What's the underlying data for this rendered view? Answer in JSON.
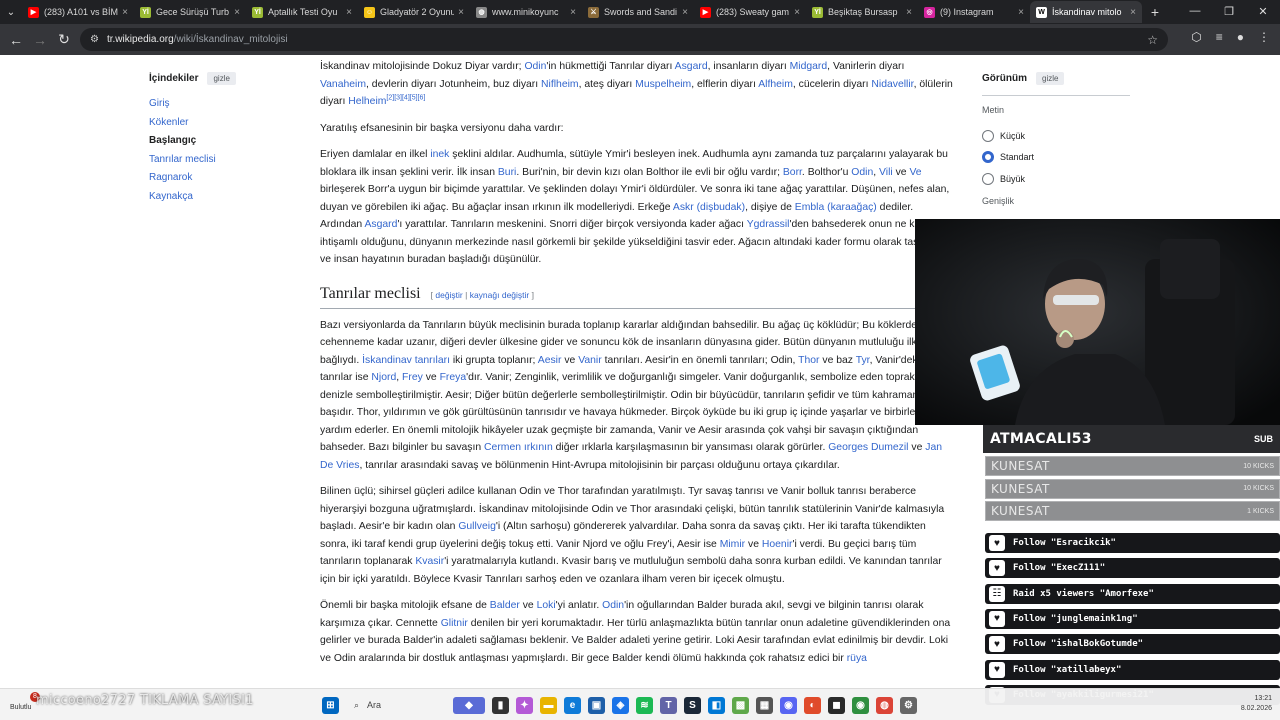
{
  "browser": {
    "tabs": [
      {
        "title": "(283) A101 vs BİM",
        "color": "#ff0000",
        "glyph": "▶"
      },
      {
        "title": "Gece Sürüşü Turb",
        "color": "#9bbb34",
        "glyph": "Yİ"
      },
      {
        "title": "Aptallık Testi Oyu",
        "color": "#9bbb34",
        "glyph": "Yİ"
      },
      {
        "title": "Gladyatör 2 Oyunu",
        "color": "#f5c518",
        "glyph": "☺"
      },
      {
        "title": "www.minikoyunc",
        "color": "#888888",
        "glyph": "◍"
      },
      {
        "title": "Swords and Sandi",
        "color": "#8b6b3a",
        "glyph": "⚔"
      },
      {
        "title": "(283) Sweaty gam",
        "color": "#ff0000",
        "glyph": "▶"
      },
      {
        "title": "Beşiktaş Bursasp",
        "color": "#9bbb34",
        "glyph": "Yİ"
      },
      {
        "title": "(9) Instagram",
        "color": "#d6249f",
        "glyph": "◎"
      },
      {
        "title": "İskandinav mitolo",
        "color": "#ffffff",
        "glyph": "W"
      }
    ],
    "url_host": "tr.wikipedia.org",
    "url_path": "/wiki/İskandinav_mitolojisi"
  },
  "toc": {
    "title": "İçindekiler",
    "hide": "gizle",
    "items": [
      "Giriş",
      "Kökenler",
      "Başlangıç",
      "Tanrılar meclisi",
      "Ragnarok",
      "Kaynakça"
    ]
  },
  "appearance": {
    "title": "Görünüm",
    "hide": "gizle",
    "text_label": "Metin",
    "options": [
      "Küçük",
      "Standart",
      "Büyük"
    ],
    "width_label": "Genişlik"
  },
  "article": {
    "p1": [
      [
        "t",
        "İskandinav mitolojisinde Dokuz Diyar vardır; "
      ],
      [
        "l",
        "Odin"
      ],
      [
        "t",
        "'in hükmettiği Tanrılar diyarı "
      ],
      [
        "l",
        "Asgard"
      ],
      [
        "t",
        ", insanların diyarı "
      ],
      [
        "l",
        "Midgard"
      ],
      [
        "t",
        ", Vanirlerin diyarı "
      ],
      [
        "l",
        "Vanaheim"
      ],
      [
        "t",
        ", devlerin diyarı Jotunheim, buz diyarı "
      ],
      [
        "l",
        "Niflheim"
      ],
      [
        "t",
        ", ateş diyarı "
      ],
      [
        "l",
        "Muspelheim"
      ],
      [
        "t",
        ", elflerin diyarı "
      ],
      [
        "l",
        "Alfheim"
      ],
      [
        "t",
        ", cücelerin diyarı "
      ],
      [
        "l",
        "Nidavellir"
      ],
      [
        "t",
        ", ölülerin diyarı "
      ],
      [
        "l",
        "Helheim"
      ],
      [
        "s",
        "[2][3][4][5][6]"
      ]
    ],
    "p2": [
      [
        "t",
        "Yaratılış efsanesinin bir başka versiyonu daha vardır:"
      ]
    ],
    "p3": [
      [
        "t",
        "Eriyen damlalar en ilkel "
      ],
      [
        "l",
        "inek"
      ],
      [
        "t",
        " şeklini aldılar. Audhumla, sütüyle Ymir'i besleyen inek. Audhumla aynı zamanda tuz parçalarını yalayarak bu bloklara ilk insan şeklini verir. İlk insan "
      ],
      [
        "l",
        "Buri"
      ],
      [
        "t",
        ". Buri'nin, bir devin kızı olan Bolthor ile evli bir oğlu vardır; "
      ],
      [
        "l",
        "Borr"
      ],
      [
        "t",
        ". Bolthor'u "
      ],
      [
        "l",
        "Odin"
      ],
      [
        "t",
        ", "
      ],
      [
        "l",
        "Vili"
      ],
      [
        "t",
        " ve "
      ],
      [
        "l",
        "Ve"
      ],
      [
        "t",
        " birleşerek Borr'a uygun bir biçimde yarattılar. Ve şeklinden dolayı Ymir'i öldürdüler. Ve sonra iki tane ağaç yarattılar. Düşünen, nefes alan, duyan ve görebilen iki ağaç. Bu ağaçlar insan ırkının ilk modelleriydi. Erkeğe "
      ],
      [
        "l",
        "Askr (dişbudak)"
      ],
      [
        "t",
        ", dişiye de "
      ],
      [
        "l",
        "Embla (karaağaç)"
      ],
      [
        "t",
        " dediler. Ardından "
      ],
      [
        "l",
        "Asgard"
      ],
      [
        "t",
        "'ı yarattılar. Tanrıların meskenini. Snorri diğer birçok versiyonda kader ağacı "
      ],
      [
        "l",
        "Ygdrassil"
      ],
      [
        "t",
        "'den bahsederek onun ne kadar ihtişamlı olduğunu, dünyanın merkezinde nasıl görkemli bir şekilde yükseldiğini tasvir eder. Ağacın altındaki kader formu olarak tasvir edilir ve insan hayatının buradan başladığı düşünülür."
      ]
    ],
    "h2_title": "Tanrılar meclisi",
    "h2_edit_open": "[ ",
    "h2_edit1": "değiştir",
    "h2_edit_sep": " | ",
    "h2_edit2": "kaynağı değiştir",
    "h2_edit_close": " ]",
    "p4": [
      [
        "t",
        "Bazı versiyonlarda da Tanrıların büyük meclisinin burada toplanıp kararlar aldığından bahsedilir. Bu ağaç üç köklüdür; Bu köklerden biri cehenneme kadar uzanır, diğeri devler ülkesine gider ve sonuncu kök de insanların dünyasına gider. Bütün dünyanın mutluluğu ilk ağaca bağlıydı. "
      ],
      [
        "l",
        "İskandinav tanrıları"
      ],
      [
        "t",
        " iki grupta toplanır; "
      ],
      [
        "l",
        "Aesir"
      ],
      [
        "t",
        " ve "
      ],
      [
        "l",
        "Vanir"
      ],
      [
        "t",
        " tanrıları. Aesir'in en önemli tanrıları; Odin, "
      ],
      [
        "l",
        "Thor"
      ],
      [
        "t",
        " ve baz "
      ],
      [
        "l",
        "Tyr"
      ],
      [
        "t",
        ", Vanir'deki önemli tanrılar ise "
      ],
      [
        "l",
        "Njord"
      ],
      [
        "t",
        ", "
      ],
      [
        "l",
        "Frey"
      ],
      [
        "t",
        " ve "
      ],
      [
        "l",
        "Freya"
      ],
      [
        "t",
        "'dır. Vanir; Zenginlik, verimlilik ve doğurganlığı simgeler. Vanir doğurganlık, sembolize eden toprak ve denizle sembolleştirilmiştir. Aesir; Diğer bütün değerlerle sembolleştirilmiştir. Odin bir büyücüdür, tanrıların şefidir ve tüm kahramanların başıdır. Thor, yıldırımın ve gök gürültüsünün tanrısıdır ve havaya hükmeder. Birçok öyküde bu iki grup iç içinde yaşarlar ve birbirlerine yardım ederler. En önemli mitolojik hikâyeler uzak geçmişte bir zamanda, Vanir ve Aesir arasında çok vahşi bir savaşın çıktığından bahseder. Bazı bilginler bu savaşın "
      ],
      [
        "l",
        "Cermen ırkının"
      ],
      [
        "t",
        " diğer ırklarla karşılaşmasının bir yansıması olarak görürler. "
      ],
      [
        "l",
        "Georges Dumezil"
      ],
      [
        "t",
        " ve "
      ],
      [
        "l",
        "Jan De Vries"
      ],
      [
        "t",
        ", tanrılar arasındaki savaş ve bölünmenin Hint-Avrupa mitolojisinin bir parçası olduğunu ortaya çıkardılar."
      ]
    ],
    "p5": [
      [
        "t",
        "Bilinen üçlü; sihirsel güçleri adilce kullanan Odin ve Thor tarafından yaratılmıştı. Tyr savaş tanrısı ve Vanir bolluk tanrısı beraberce hiyerarşiyi bozguna uğratmışlardı. İskandinav mitolojisinde Odin ve Thor arasındaki çelişki, bütün tanrılık statülerinin Vanir'de kalmasıyla başladı. Aesir'e bir kadın olan "
      ],
      [
        "l",
        "Gullveig"
      ],
      [
        "t",
        "'i (Altın sarhoşu) göndererek yalvardılar. Daha sonra da savaş çıktı. Her iki tarafta tükendikten sonra, iki taraf kendi grup üyelerini değiş tokuş etti. Vanir Njord ve oğlu Frey'i, Aesir ise "
      ],
      [
        "l",
        "Mimir"
      ],
      [
        "t",
        " ve "
      ],
      [
        "l",
        "Hoenir"
      ],
      [
        "t",
        "'i verdi. Bu geçici barış tüm tanrıların toplanarak "
      ],
      [
        "l",
        "Kvasir"
      ],
      [
        "t",
        "'i yaratmalarıyla kutlandı. Kvasir barış ve mutluluğun sembolü daha sonra kurban edildi. Ve kanından tanrılar için bir içki yaratıldı. Böylece Kvasir Tanrıları sarhoş eden ve ozanlara ilham veren bir içecek olmuştu."
      ]
    ],
    "p6": [
      [
        "t",
        "Önemli bir başka mitolojik efsane de "
      ],
      [
        "l",
        "Balder"
      ],
      [
        "t",
        " ve "
      ],
      [
        "l",
        "Loki"
      ],
      [
        "t",
        "'yi anlatır. "
      ],
      [
        "l",
        "Odin"
      ],
      [
        "t",
        "'in oğullarından Balder burada akıl, sevgi ve bilginin tanrısı olarak karşımıza çıkar. Cennette "
      ],
      [
        "l",
        "Glitnir"
      ],
      [
        "t",
        " denilen bir yeri korumaktadır. Her türlü anlaşmazlıkta bütün tanrılar onun adaletine güvendiklerinden ona gelirler ve burada Balder'in adaleti sağlaması beklenir. Ve Balder adaleti yerine getirir. Loki Aesir tarafından evlat edinilmiş bir devdir. Loki ve Odin aralarında bir dostluk antlaşması yapmışlardı. Bir gece Balder kendi ölümü hakkında çok rahatsız edici bir "
      ],
      [
        "l",
        "rüya"
      ]
    ]
  },
  "stream": {
    "alert_name": "ATMACALI53",
    "alert_tag": "SUB",
    "kicks": [
      {
        "name": "KUNESAT",
        "amount": "10 KICKS"
      },
      {
        "name": "KUNESAT",
        "amount": "10 KICKS"
      },
      {
        "name": "KUNESAT",
        "amount": "1 KICKS"
      }
    ],
    "events": [
      {
        "icon": "♥",
        "text": "Follow \"Esracikcik\""
      },
      {
        "icon": "♥",
        "text": "Follow \"ExecZ111\""
      },
      {
        "icon": "☷",
        "text": "Raid x5 viewers \"Amorfexe\""
      },
      {
        "icon": "♥",
        "text": "Follow \"junglemaink1ng\""
      },
      {
        "icon": "♥",
        "text": "Follow \"ishalBokGotumde\""
      },
      {
        "icon": "♥",
        "text": "Follow \"xatillabeyx\""
      },
      {
        "icon": "♥",
        "text": "Follow \"ayakkiligurmesi21\""
      }
    ],
    "overlay_text": "miccoeno2727  TIKLAMA SAYISI1"
  },
  "taskbar": {
    "weather": "Bulutlu",
    "badge": "8",
    "search": "Ara",
    "time": "13:21",
    "date": "8.02.2026"
  }
}
